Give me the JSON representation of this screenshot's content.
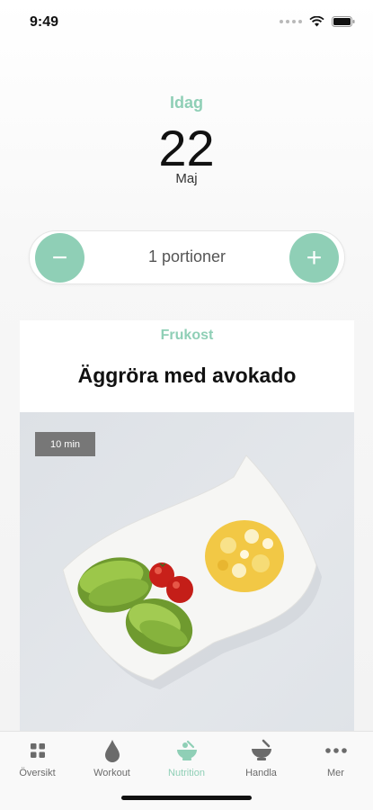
{
  "status_bar": {
    "time": "9:49"
  },
  "date": {
    "label": "Idag",
    "day": "22",
    "month": "Maj"
  },
  "portions": {
    "minus": "−",
    "plus": "+",
    "label": "1 portioner"
  },
  "meal": {
    "type": "Frukost",
    "title": "Äggröra med avokado",
    "time": "10 min"
  },
  "tabs": [
    {
      "label": "Översikt",
      "icon": "grid-icon"
    },
    {
      "label": "Workout",
      "icon": "drop-icon"
    },
    {
      "label": "Nutrition",
      "icon": "bowl-icon",
      "active": true
    },
    {
      "label": "Handla",
      "icon": "mortar-icon"
    },
    {
      "label": "Mer",
      "icon": "more-icon"
    }
  ],
  "colors": {
    "accent": "#8fcfb6",
    "icon_gray": "#6b6b6b"
  }
}
